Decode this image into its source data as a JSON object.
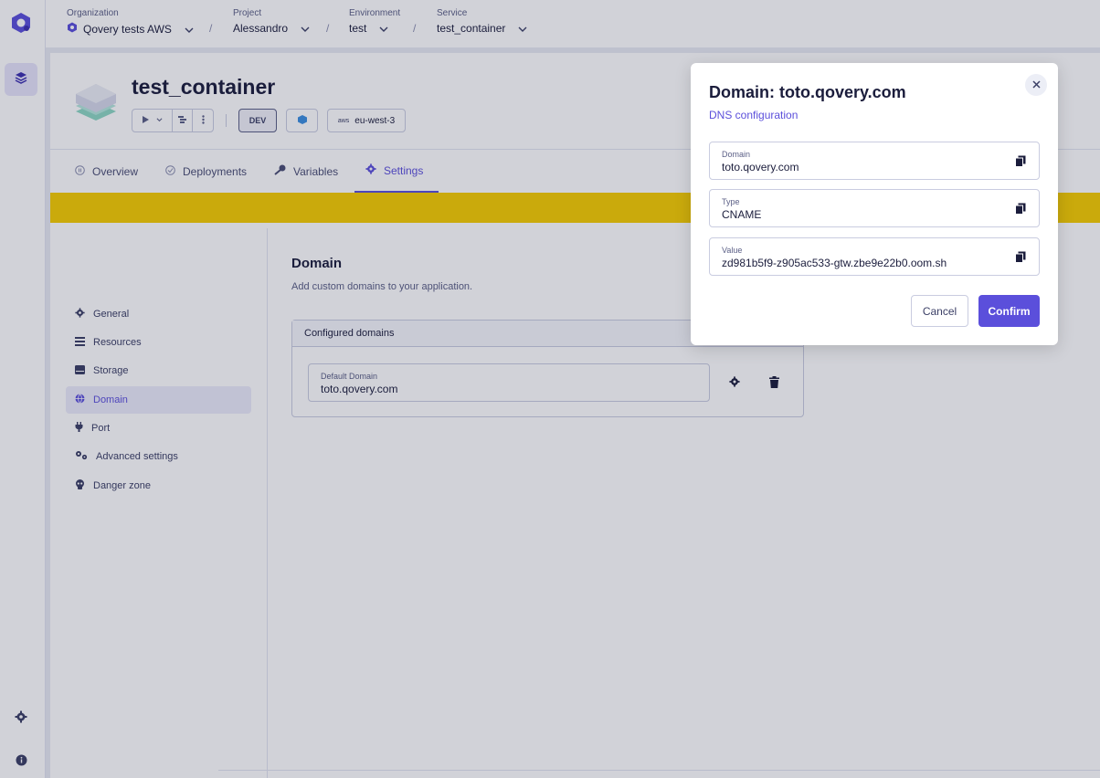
{
  "breadcrumb": {
    "organization": {
      "label": "Organization",
      "value": "Qovery tests AWS"
    },
    "project": {
      "label": "Project",
      "value": "Alessandro"
    },
    "environment": {
      "label": "Environment",
      "value": "test"
    },
    "service": {
      "label": "Service",
      "value": "test_container"
    },
    "separator": "/"
  },
  "service": {
    "title": "test_container",
    "env_badge": "DEV",
    "region_provider": "aws",
    "region": "eu-west-3"
  },
  "tabs": [
    {
      "label": "Overview"
    },
    {
      "label": "Deployments"
    },
    {
      "label": "Variables"
    },
    {
      "label": "Settings"
    }
  ],
  "sidenav": [
    {
      "label": "General"
    },
    {
      "label": "Resources"
    },
    {
      "label": "Storage"
    },
    {
      "label": "Domain"
    },
    {
      "label": "Port"
    },
    {
      "label": "Advanced settings"
    },
    {
      "label": "Danger zone"
    }
  ],
  "main": {
    "title": "Domain",
    "description": "Add custom domains to your application.",
    "card_header": "Configured domains",
    "domain_label": "Default Domain",
    "domain_value": "toto.qovery.com"
  },
  "modal": {
    "title": "Domain: toto.qovery.com",
    "subtitle": "DNS configuration",
    "fields": [
      {
        "label": "Domain",
        "value": "toto.qovery.com"
      },
      {
        "label": "Type",
        "value": "CNAME"
      },
      {
        "label": "Value",
        "value": "zd981b5f9-z905ac533-gtw.zbe9e22b0.oom.sh"
      }
    ],
    "cancel_label": "Cancel",
    "confirm_label": "Confirm"
  },
  "colors": {
    "accent": "#5b4fdb",
    "banner": "#f7cd00",
    "text": "#1b1d3c"
  }
}
